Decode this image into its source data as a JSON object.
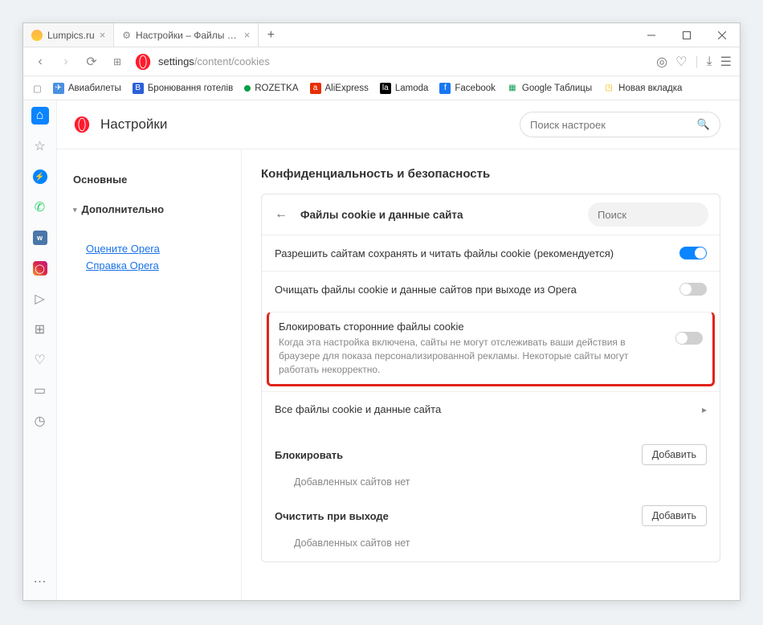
{
  "tabs": [
    {
      "title": "Lumpics.ru",
      "active": false
    },
    {
      "title": "Настройки – Файлы cookie",
      "active": true
    }
  ],
  "addressbar": {
    "prefix": "settings",
    "suffix": "/content/cookies"
  },
  "bookmarks": [
    {
      "label": "Авиабилеты",
      "color": "#4a90e2"
    },
    {
      "label": "Бронювання готелів",
      "color": "#2b5fd9"
    },
    {
      "label": "ROZETKA",
      "color": "#00a046"
    },
    {
      "label": "AliExpress",
      "color": "#e62e04"
    },
    {
      "label": "Lamoda",
      "color": "#000"
    },
    {
      "label": "Facebook",
      "color": "#1877f2"
    },
    {
      "label": "Google Таблицы",
      "color": "#0f9d58"
    },
    {
      "label": "Новая вкладка",
      "color": "#f5b400"
    }
  ],
  "settings": {
    "pageTitle": "Настройки",
    "searchPlaceholder": "Поиск настроек",
    "nav": {
      "basic": "Основные",
      "advanced": "Дополнительно",
      "rateLink": "Оцените Opera",
      "helpLink": "Справка Opera"
    },
    "sectionTitle": "Конфиденциальность и безопасность",
    "card": {
      "title": "Файлы cookie и данные сайта",
      "searchPlaceholder": "Поиск",
      "row1": "Разрешить сайтам сохранять и читать файлы cookie (рекомендуется)",
      "row2": "Очищать файлы cookie и данные сайтов при выходе из Opera",
      "row3title": "Блокировать сторонние файлы cookie",
      "row3sub": "Когда эта настройка включена, сайты не могут отслеживать ваши действия в браузере для показа персонализированной рекламы. Некоторые сайты могут работать некорректно.",
      "row4": "Все файлы cookie и данные сайта"
    },
    "blockSection": {
      "title": "Блокировать",
      "button": "Добавить",
      "empty": "Добавленных сайтов нет"
    },
    "clearSection": {
      "title": "Очистить при выходе",
      "button": "Добавить",
      "empty": "Добавленных сайтов нет"
    }
  }
}
